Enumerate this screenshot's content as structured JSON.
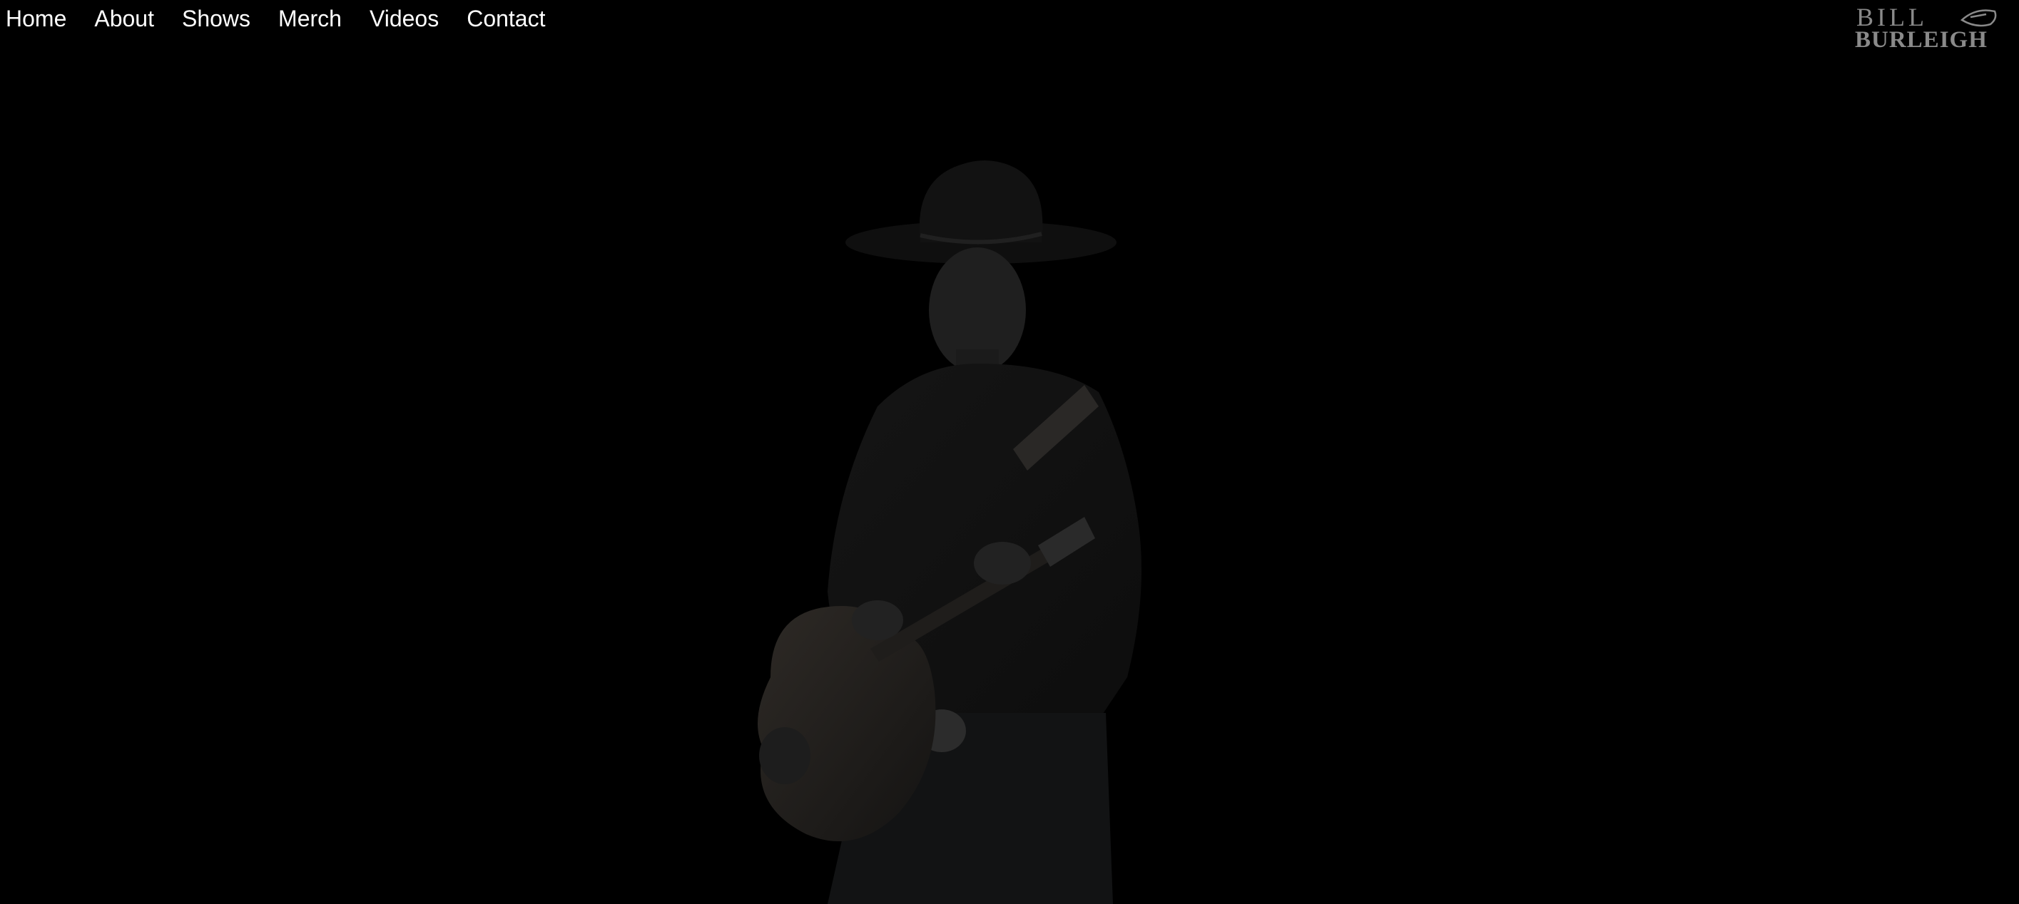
{
  "nav": {
    "items": [
      {
        "label": "Home"
      },
      {
        "label": "About"
      },
      {
        "label": "Shows"
      },
      {
        "label": "Merch"
      },
      {
        "label": "Videos"
      },
      {
        "label": "Contact"
      }
    ]
  },
  "logo": {
    "line1": "BILL",
    "line2": "BURLEIGH",
    "color": "#8a8a8a"
  },
  "hero": {
    "subject": "cowboy-with-guitar",
    "tint": "#1a1a1a"
  }
}
